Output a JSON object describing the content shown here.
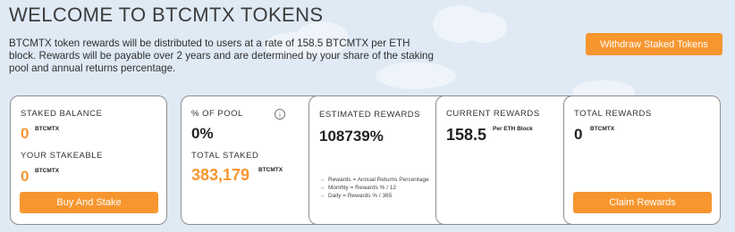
{
  "header": {
    "title": "WELCOME TO BTCMTX TOKENS",
    "description": "BTCMTX token rewards will be distributed to users at a rate of 158.5 BTCMTX per ETH block. Rewards will be payable over 2 years and are determined by your share of the staking pool and annual returns percentage.",
    "withdraw_label": "Withdraw Staked Tokens"
  },
  "cards": {
    "staked": {
      "label": "STAKED BALANCE",
      "value": "0",
      "unit": "BTCMTX",
      "stakeable_label": "YOUR STAKEABLE",
      "stakeable_value": "0",
      "stakeable_unit": "BTCMTX",
      "button": "Buy And Stake"
    },
    "pool": {
      "label": "% OF POOL",
      "value": "0%",
      "info_icon": "i",
      "total_label": "TOTAL STAKED",
      "total_value": "383,179",
      "total_unit": "BTCMTX"
    },
    "estimated": {
      "label": "ESTIMATED REWARDS",
      "value": "108739%",
      "notes": [
        "Rewards = Annual Returns Percentage",
        "Monthly = Rewards % / 12",
        "Daily = Rewards % / 365"
      ],
      "arrow": "→"
    },
    "current": {
      "label": "CURRENT REWARDS",
      "value": "158.5",
      "unit": "Per ETH Block"
    },
    "total": {
      "label": "TOTAL REWARDS",
      "value": "0",
      "unit": "BTCMTX",
      "button": "Claim Rewards"
    }
  },
  "colors": {
    "accent": "#f7962f",
    "background": "#dfeaf5",
    "card": "#ffffff"
  }
}
